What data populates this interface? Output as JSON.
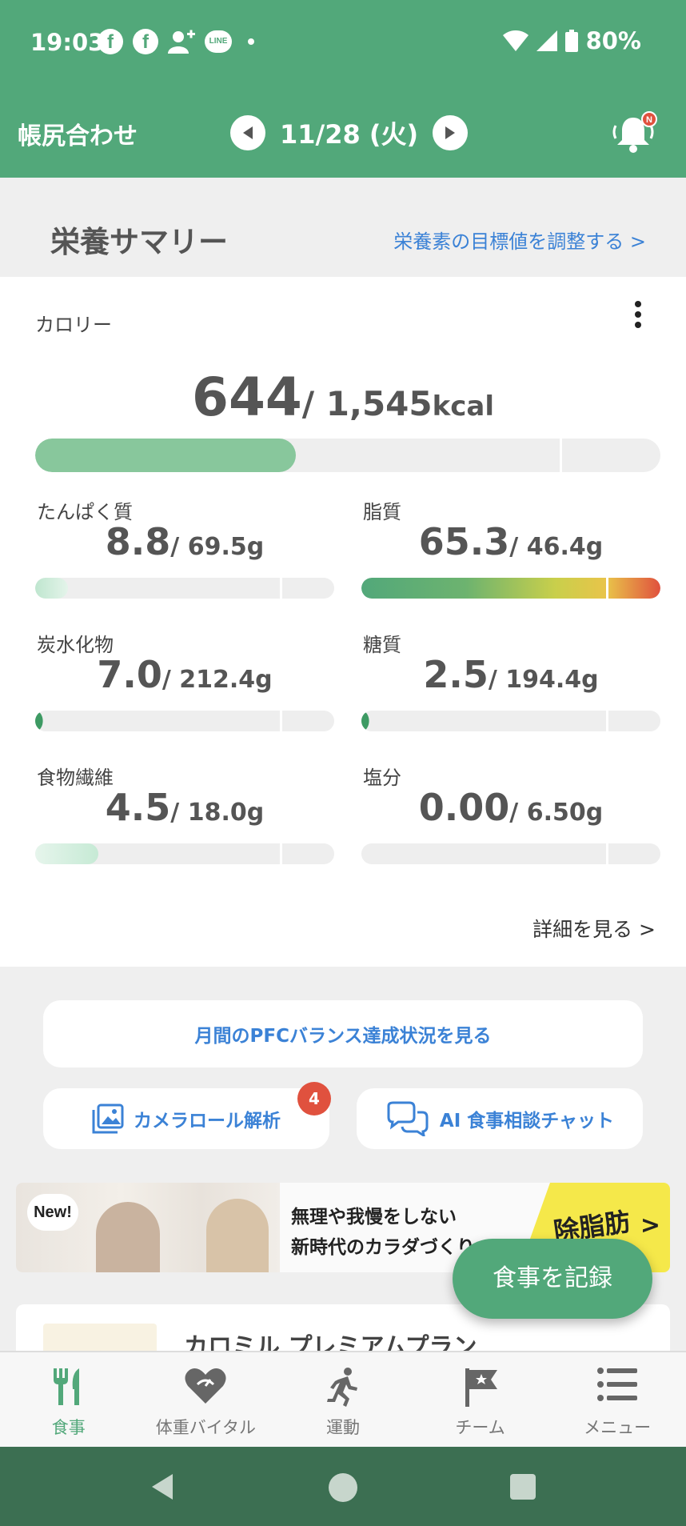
{
  "status": {
    "time": "19:03",
    "battery": "80%",
    "fb_label": "f",
    "line_label": "LINE"
  },
  "header": {
    "title": "帳尻合わせ",
    "date": "11/28 (火)",
    "notify_badge": "N"
  },
  "summary": {
    "title": "栄養サマリー",
    "adjust_link": "栄養素の目標値を調整する >"
  },
  "calorie": {
    "label": "カロリー",
    "value": "644",
    "target": "/ 1,545",
    "unit": "kcal",
    "progress": 0.417
  },
  "nutrients": [
    {
      "label": "たんぱく質",
      "value": "8.8",
      "target": "/ 69.5g",
      "progress": 0.11
    },
    {
      "label": "脂質",
      "value": "65.3",
      "target": "/ 46.4g",
      "progress": 1.0
    },
    {
      "label": "炭水化物",
      "value": "7.0",
      "target": "/ 212.4g",
      "progress": 0.025
    },
    {
      "label": "糖質",
      "value": "2.5",
      "target": "/ 194.4g",
      "progress": 0.012
    },
    {
      "label": "食物繊維",
      "value": "4.5",
      "target": "/ 18.0g",
      "progress": 0.21
    },
    {
      "label": "塩分",
      "value": "0.00",
      "target": "/ 6.50g",
      "progress": 0.0
    }
  ],
  "detail_link": "詳細を見る >",
  "actions": {
    "pfc": "月間のPFCバランス達成状況を見る",
    "camera": "カメラロール解析",
    "camera_badge": "4",
    "ai_chat": "AI 食事相談チャット"
  },
  "banner": {
    "new": "New!",
    "line1": "無理や我慢をしない",
    "line2": "新時代のカラダづくり",
    "yellow_text": "除脂肪",
    "chevron": ">"
  },
  "fab": "食事を記録",
  "premium": {
    "title": "カロミル プレミアムプラン",
    "icon": "✦"
  },
  "nav": [
    {
      "label": "食事",
      "icon": "fork-knife-icon",
      "active": true
    },
    {
      "label": "体重バイタル",
      "icon": "heart-gauge-icon",
      "active": false
    },
    {
      "label": "運動",
      "icon": "running-icon",
      "active": false
    },
    {
      "label": "チーム",
      "icon": "flag-icon",
      "active": false
    },
    {
      "label": "メニュー",
      "icon": "list-icon",
      "active": false
    }
  ],
  "colors": {
    "primary": "#52a87a",
    "link": "#3b82d6",
    "badge": "#e0513e",
    "sysnav": "#3c6f52"
  }
}
